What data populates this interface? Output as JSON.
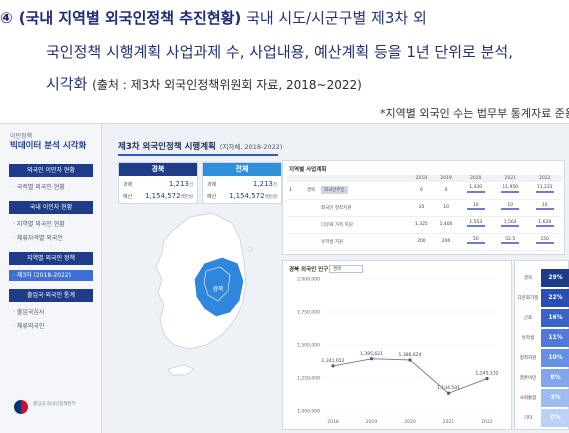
{
  "lines": {
    "l1_num": "④",
    "l1_bold": "(국내 지역별 외국인정책 추진현황)",
    "l1_rest": " 국내 시도/시군구별 제3차 외",
    "l2": "국인정책 시행계획 사업과제 수, 사업내용, 예산계획 등을 1년 단위로 분석,",
    "l3_main": "시각화 ",
    "l3_src": "(출처 : 제3차 외국인정책위원회 자료, 2018~2022)"
  },
  "note": "*지역별 외국인 수는 법무부 통계자료 준용",
  "dashboard": {
    "sidebar": {
      "brand_small": "이민정책",
      "brand": "빅데이터 분석 시각화",
      "menu": [
        {
          "type": "head",
          "label": "외국인 이민자 현황"
        },
        {
          "type": "item",
          "label": "· 국적별 외국인 현황"
        },
        {
          "type": "head",
          "label": "국내 이민자 현황"
        },
        {
          "type": "item",
          "label": "· 지역별 외국인 현황"
        },
        {
          "type": "item",
          "label": "· 체류자격별 외국인"
        },
        {
          "type": "head",
          "label": "지역별 외국인 정책"
        },
        {
          "type": "active",
          "label": "· 제3차 (2018-2022)"
        },
        {
          "type": "head",
          "label": "출입국·외국인 통계"
        },
        {
          "type": "item",
          "label": "· 출입국심사"
        },
        {
          "type": "item",
          "label": "· 체류외국인"
        }
      ],
      "gov_text": "출입국·외국인정책본부"
    },
    "title": "제3차 외국인정책 시행계획",
    "title_sub": "(지자체, 2018-2022)",
    "cards": [
      {
        "header": "경북",
        "color": "#1f3c88",
        "r1_label": "과제",
        "r1_value": "1,213",
        "r1_unit": "건",
        "r2_label": "예산",
        "r2_value": "1,154,572",
        "r2_unit": "백만원"
      },
      {
        "header": "전체",
        "color": "#2f8fd8",
        "r1_label": "과제",
        "r1_value": "1,213",
        "r1_unit": "건",
        "r2_label": "예산",
        "r2_value": "1,154,572",
        "r2_unit": "백만원"
      }
    ],
    "map_label": "경북",
    "table": {
      "title": "지역별 사업계획",
      "columns": [
        "",
        "",
        "",
        "2018",
        "2019",
        "2020",
        "2021",
        "2022"
      ],
      "rows": [
        {
          "c0": "1",
          "c1": "경북",
          "c2": "외국인주민",
          "v": [
            "0",
            "0",
            "1,430",
            "11,950",
            "11,231"
          ]
        },
        {
          "c0": "",
          "c1": "",
          "c2": "외국인 정착지원",
          "v": [
            "10",
            "10",
            "10",
            "10",
            "10"
          ]
        },
        {
          "c0": "",
          "c1": "",
          "c2": "다문화 가족 지원",
          "v": [
            "1,325",
            "1,406",
            "1,553",
            "1,564",
            "1,628"
          ]
        },
        {
          "c0": "",
          "c1": "",
          "c2": "유학생 지원",
          "v": [
            "200",
            "200",
            "50",
            "52.5",
            "150"
          ]
        }
      ]
    },
    "line_chart": {
      "title": "경북 외국인 인구",
      "select": "경북",
      "y_ticks": [
        "2,000,000",
        "1,750,000",
        "1,500,000",
        "1,250,000",
        "1,000,000"
      ],
      "x_ticks": [
        "2018",
        "2019",
        "2020",
        "2021",
        "2022"
      ],
      "labels": [
        "1,341,652",
        "1,395,621",
        "1,386,624",
        "1,134,591",
        "1,245,132"
      ],
      "values": [
        1341652,
        1395621,
        1386624,
        1134591,
        1245132
      ]
    },
    "ranks": [
      {
        "label": "경북",
        "value": "29%",
        "color": "#1f3c88"
      },
      {
        "label": "다문화가정",
        "value": "22%",
        "color": "#2a4fb4"
      },
      {
        "label": "근로",
        "value": "16%",
        "color": "#3a63c8"
      },
      {
        "label": "유학생",
        "value": "11%",
        "color": "#4f79da"
      },
      {
        "label": "정착지원",
        "value": "10%",
        "color": "#6790e4"
      },
      {
        "label": "결혼이민",
        "value": "8%",
        "color": "#82a6ec"
      },
      {
        "label": "사회통합",
        "value": "3%",
        "color": "#9fbcf2"
      },
      {
        "label": "기타",
        "value": "0%",
        "color": "#bcd1f7"
      }
    ]
  }
}
